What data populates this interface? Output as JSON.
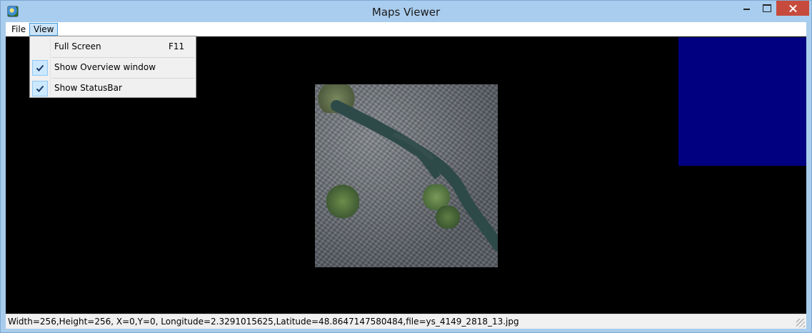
{
  "window": {
    "title": "Maps Viewer"
  },
  "menubar": {
    "file_label": "File",
    "view_label": "View"
  },
  "view_menu": {
    "items": [
      {
        "label": "Full Screen",
        "shortcut": "F11",
        "checked": false
      },
      {
        "label": "Show Overview window",
        "shortcut": "",
        "checked": true
      },
      {
        "label": "Show StatusBar",
        "shortcut": "",
        "checked": true
      }
    ]
  },
  "overview": {
    "color": "#000080"
  },
  "statusbar": {
    "text": "Width=256,Height=256, X=0,Y=0, Longitude=2.3291015625,Latitude=48.8647147580484,file=ys_4149_2818_13.jpg"
  },
  "colors": {
    "titlebar": "#a9cdee",
    "close_button": "#c74b3c",
    "map_background": "#000000"
  },
  "icons": [
    "app-icon",
    "minimize-icon",
    "maximize-icon",
    "close-icon",
    "checkmark-icon",
    "size-grip-icon"
  ]
}
